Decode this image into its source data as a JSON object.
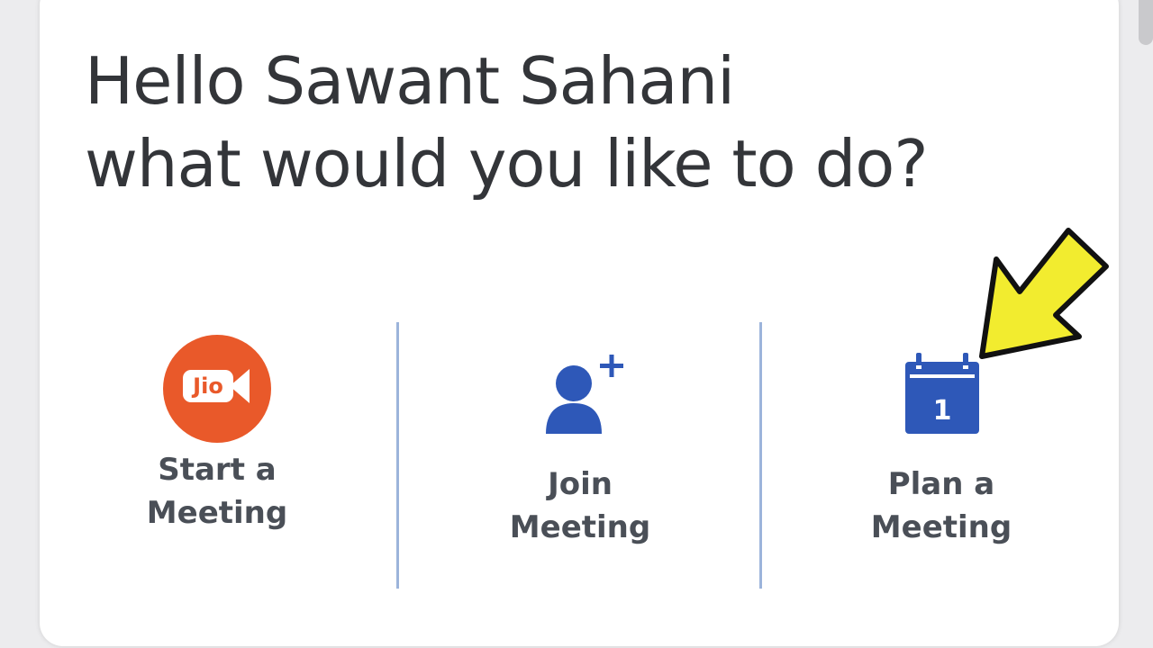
{
  "greeting": {
    "line1": "Hello Sawant Sahani",
    "line2": "what would you like to do?"
  },
  "options": [
    {
      "label": "Start a\nMeeting",
      "icon": "jio-video-icon",
      "icon_text": "Jio"
    },
    {
      "label": "Join\nMeeting",
      "icon": "add-person-icon"
    },
    {
      "label": "Plan a\nMeeting",
      "icon": "calendar-icon",
      "icon_text": "1"
    }
  ],
  "colors": {
    "brand_orange": "#e9592a",
    "icon_blue": "#2e58b8",
    "divider": "#9cb4db",
    "text": "#4a4f57",
    "annotation_arrow": "#f2ec2f"
  }
}
